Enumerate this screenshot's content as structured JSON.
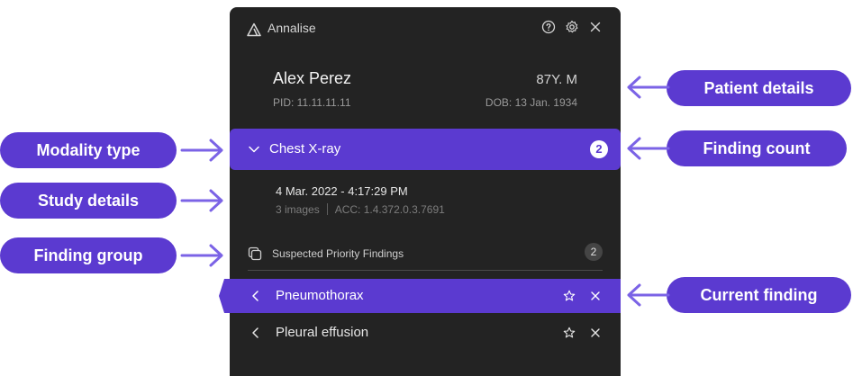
{
  "app": {
    "name": "Annalise"
  },
  "header": {
    "icons": [
      "help-icon",
      "settings-icon",
      "close-icon"
    ]
  },
  "patient": {
    "name": "Alex Perez",
    "age_sex": "87Y. M",
    "pid": "PID: 11.11.11.11",
    "dob": "DOB: 13 Jan. 1934"
  },
  "modality": {
    "label": "Chest X-ray",
    "count": "2"
  },
  "study": {
    "datetime": "4 Mar. 2022 - 4:17:29 PM",
    "images": "3 images",
    "acc": "ACC: 1.4.372.0.3.7691"
  },
  "finding_group": {
    "label": "Suspected Priority Findings",
    "count": "2"
  },
  "findings": [
    {
      "name": "Pneumothorax",
      "current": true
    },
    {
      "name": "Pleural effusion",
      "current": false
    }
  ],
  "callouts": {
    "patient_details": "Patient details",
    "finding_count": "Finding count",
    "current_finding": "Current finding",
    "modality_type": "Modality type",
    "study_details": "Study details",
    "finding_group": "Finding group"
  },
  "colors": {
    "accent": "#5b3ad0",
    "arrow": "#7b63e6",
    "panel": "#232323"
  }
}
